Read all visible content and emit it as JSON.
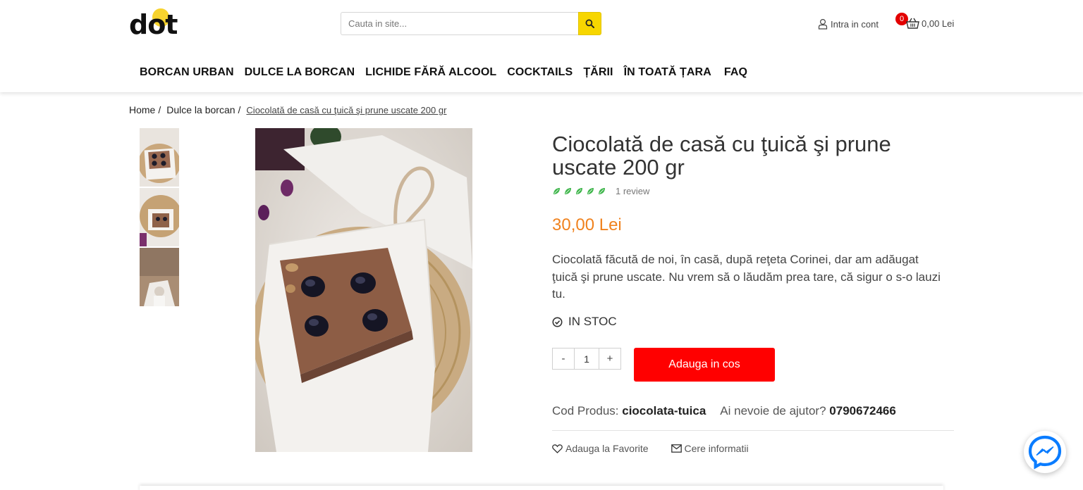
{
  "header": {
    "logo_text": "dot",
    "search_placeholder": "Cauta in site...",
    "account_label": "Intra in cont",
    "cart_count": "0",
    "cart_total": "0,00 Lei",
    "colors": {
      "search_button": "#f7d600",
      "cart_badge": "#e30000"
    }
  },
  "nav": {
    "items": [
      {
        "label": "BORCAN URBAN"
      },
      {
        "label": "DULCE LA BORCAN"
      },
      {
        "label": "LICHIDE FĂRĂ ALCOOL"
      },
      {
        "label": "COCKTAILS"
      },
      {
        "label": "ȚĂRII"
      },
      {
        "label": "ÎN TOATĂ ȚARA"
      },
      {
        "label": "FAQ"
      }
    ]
  },
  "breadcrumb": {
    "items": [
      {
        "label": "Home"
      },
      {
        "label": "Dulce la borcan"
      }
    ],
    "current": "Ciocolată de casă cu ţuică şi prune uscate 200 gr"
  },
  "product": {
    "title": "Ciocolată de casă cu ţuică şi prune uscate 200 gr",
    "rating": 5,
    "rating_max": 5,
    "review_count_label": "1 review",
    "price": "30,00 Lei",
    "description": "Ciocolată făcută de noi, în casă, după reţeta Corinei, dar am adăugat ţuică şi prune uscate. Nu vrem să o lăudăm prea tare, că sigur o s-o lauzi tu.",
    "stock": "IN STOC",
    "quantity": "1",
    "qty_minus": "-",
    "qty_plus": "+",
    "add_to_cart": "Adauga in cos",
    "code_label": "Cod Produs:",
    "code_value": "ciocolata-tuica",
    "help_label": "Ai nevoie de ajutor?",
    "help_phone": "0790672466",
    "favorite_label": "Adauga la Favorite",
    "info_label": "Cere informatii",
    "colors": {
      "price": "#f0821e",
      "add_button": "#ff0000",
      "rating_leaf": "#3db54a"
    }
  },
  "icons": {
    "search": "search-icon",
    "account": "user-icon",
    "cart": "basket-icon",
    "stock": "check-circle-icon",
    "favorite": "heart-icon",
    "info": "envelope-icon",
    "messenger": "messenger-icon"
  }
}
